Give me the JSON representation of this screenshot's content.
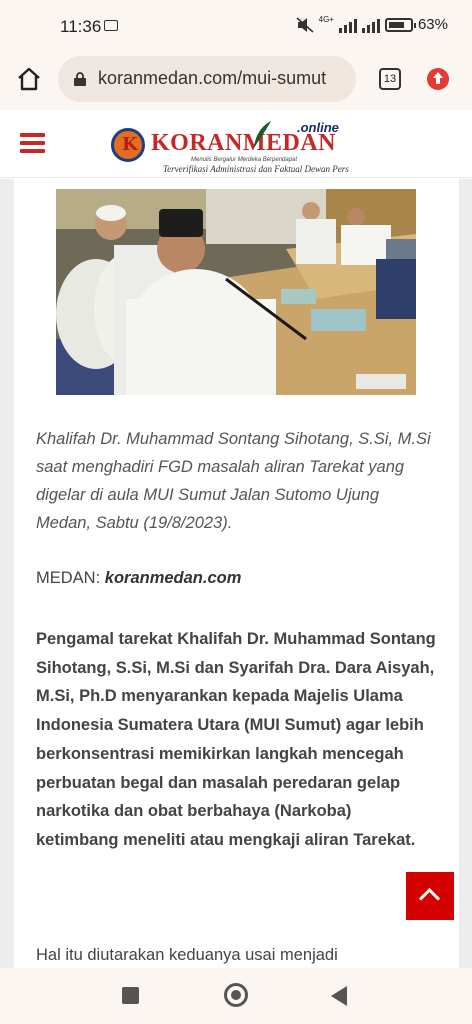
{
  "status_bar": {
    "time": "11:36",
    "network": "4G+",
    "battery": "63%"
  },
  "browser": {
    "url": "koranmedan.com/mui-sumut",
    "tab_count": "13"
  },
  "site": {
    "logo_name": "KORANMEDAN",
    "logo_online": ".online",
    "logo_tagline_small": "Menulis Bergalur Merdeka Berpendapat",
    "logo_tagline": "Terverifikasi Administrasi dan Faktual Dewan Pers"
  },
  "article": {
    "caption": "Khalifah Dr. Muhammad Sontang Sihotang, S.Si, M.Si saat menghadiri FGD masalah aliran Tarekat yang digelar di aula MUI Sumut Jalan Sutomo Ujung Medan, Sabtu (19/8/2023).",
    "dateline_city": "MEDAN:",
    "dateline_source": "koranmedan.com",
    "lead": "Pengamal tarekat Khalifah Dr. Muhammad Sontang Sihotang, S.Si, M.Si dan Syarifah Dra. Dara Aisyah, M.Si, Ph.D menyarankan kepada Majelis Ulama Indonesia Sumatera Utara (MUI Sumut) agar lebih berkonsentrasi memikirkan langkah mencegah perbuatan begal dan masalah peredaran gelap narkotika dan obat berbahaya (Narkoba) ketimbang meneliti atau mengkaji aliran Tarekat.",
    "paragraph_2": "Hal itu diutarakan keduanya usai menjadi"
  },
  "colors": {
    "brand_red": "#c62828",
    "scroll_top_red": "#d50000"
  }
}
